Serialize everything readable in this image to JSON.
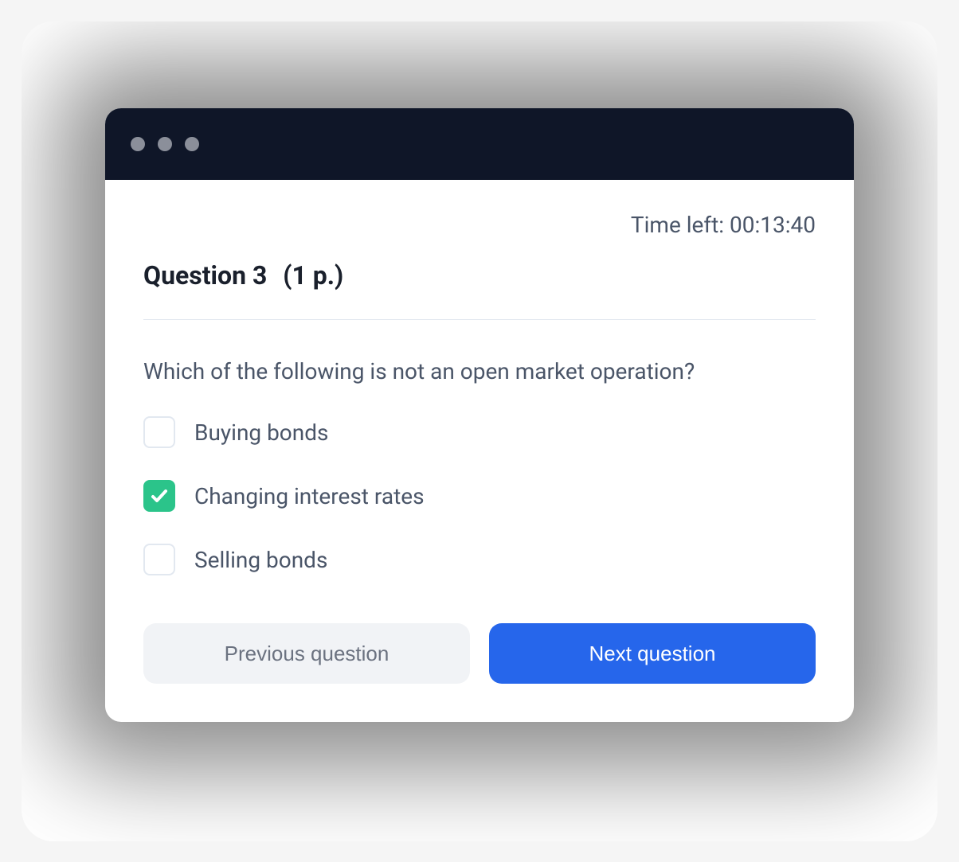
{
  "timer": {
    "label": "Time left: ",
    "value": "00:13:40"
  },
  "question": {
    "number_label": "Question 3",
    "points_label": "(1 p.)",
    "text": "Which of the following is not an open market operation?"
  },
  "options": [
    {
      "label": "Buying bonds",
      "checked": false
    },
    {
      "label": "Changing interest rates",
      "checked": true
    },
    {
      "label": "Selling bonds",
      "checked": false
    }
  ],
  "nav": {
    "prev": "Previous question",
    "next": "Next question"
  },
  "colors": {
    "titlebar": "#0f1628",
    "accent_green": "#2BC48A",
    "accent_blue": "#2666eb",
    "text_dark": "#1a202c",
    "text_muted": "#4a5568"
  }
}
